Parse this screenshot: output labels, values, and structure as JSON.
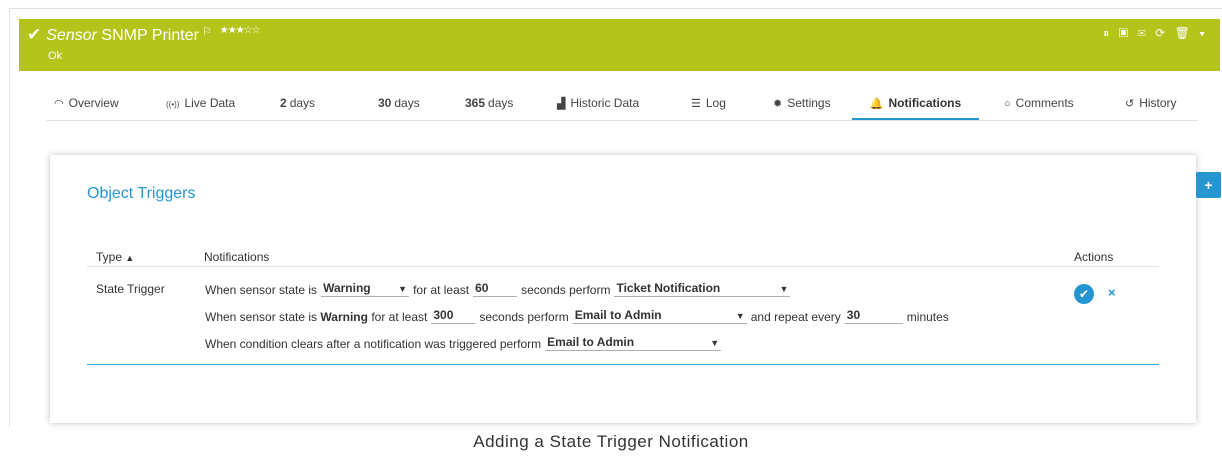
{
  "header": {
    "check": "✔",
    "kind": "Sensor",
    "name": "SNMP Printer",
    "flag": "⚐",
    "stars": "★★★☆☆",
    "status": "Ok",
    "tools": "⏸ ▣ ✉ ⟳ 🗑 ▾"
  },
  "tabs": [
    {
      "icon": "◠",
      "label": "Overview"
    },
    {
      "icon": "((•))",
      "label": "Live Data"
    },
    {
      "num": "2",
      "label": "days"
    },
    {
      "num": "30",
      "label": "days"
    },
    {
      "num": "365",
      "label": "days"
    },
    {
      "icon": "▟",
      "label": "Historic Data"
    },
    {
      "icon": "☰",
      "label": "Log"
    },
    {
      "icon": "✹",
      "label": "Settings"
    },
    {
      "icon": "🔔",
      "label": "Notifications"
    },
    {
      "icon": "○",
      "label": "Comments"
    },
    {
      "icon": "↺",
      "label": "History"
    }
  ],
  "panel": {
    "title": "Object Triggers",
    "columns": {
      "type": "Type",
      "sort_icon": "▲",
      "notifications": "Notifications",
      "actions": "Actions"
    },
    "row": {
      "type": "State Trigger",
      "line1": {
        "t1": "When sensor state is",
        "state": "Warning",
        "t2": "for at least",
        "seconds": "60",
        "t3": "seconds perform",
        "action": "Ticket Notification"
      },
      "line2": {
        "t1": "When sensor state is",
        "state": "Warning",
        "t2": "for at least",
        "seconds": "300",
        "t3": "seconds perform",
        "action": "Email to Admin",
        "t4": "and repeat every",
        "repeat": "30",
        "t5": "minutes"
      },
      "line3": {
        "t1": "When condition clears after a notification was triggered perform",
        "action": "Email to Admin"
      },
      "dropdown_arrow": "▼"
    }
  },
  "side_button": "+",
  "caption": "Adding a State Trigger Notification"
}
